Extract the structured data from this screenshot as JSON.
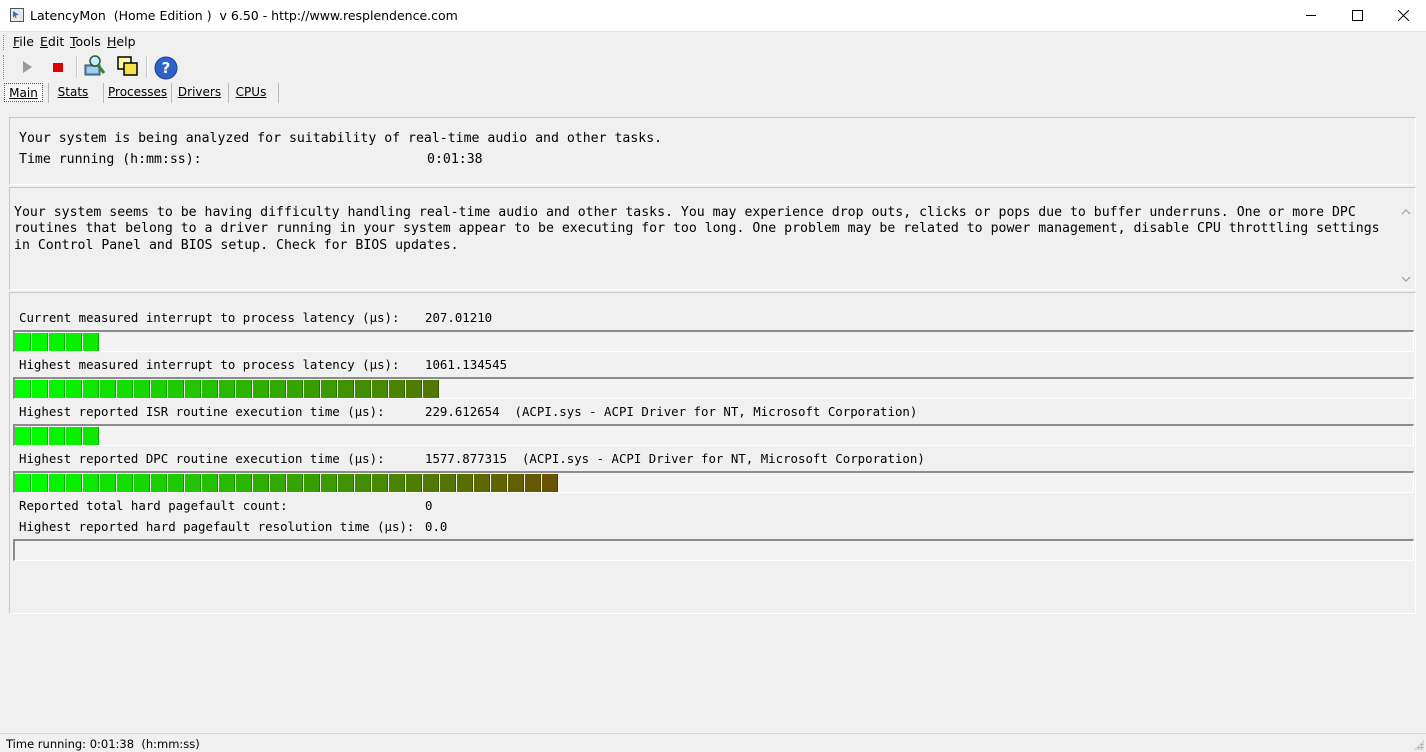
{
  "window": {
    "title": "LatencyMon  (Home Edition )  v 6.50 - http://www.resplendence.com"
  },
  "menu": {
    "items": [
      {
        "label": "File",
        "accel": "F"
      },
      {
        "label": "Edit",
        "accel": "E"
      },
      {
        "label": "Tools",
        "accel": "T"
      },
      {
        "label": "Help",
        "accel": "H"
      }
    ]
  },
  "toolbar": {
    "icons": [
      "play-icon",
      "stop-icon",
      "analyze-icon",
      "windows-icon",
      "help-icon"
    ]
  },
  "tabs": [
    {
      "label": "Main",
      "active": true
    },
    {
      "label": "Stats",
      "active": false
    },
    {
      "label": "Processes",
      "active": false
    },
    {
      "label": "Drivers",
      "active": false
    },
    {
      "label": "CPUs",
      "active": false
    }
  ],
  "status_panel": {
    "message": "Your system is being analyzed for suitability of real-time audio and other tasks.",
    "time_label": "Time running (h:mm:ss):",
    "time_value": "0:01:38"
  },
  "conclusion": {
    "text": "Your system seems to be having difficulty handling real-time audio and other tasks. You may experience drop outs, clicks or pops due to buffer underruns. One or more DPC routines that belong to a driver running in your system appear to be executing for too long. One problem may be related to power management, disable CPU throttling settings in Control Panel and BIOS setup. Check for BIOS updates."
  },
  "metrics": {
    "current_latency": {
      "label": "Current measured interrupt to process latency (µs):",
      "value": "207.01210",
      "segments": 5
    },
    "highest_latency": {
      "label": "Highest measured interrupt to process latency (µs):",
      "value": "1061.134545",
      "segments": 25
    },
    "isr": {
      "label": "Highest reported ISR routine execution time (µs):",
      "value": "229.612654  (ACPI.sys - ACPI Driver for NT, Microsoft Corporation)",
      "segments": 5
    },
    "dpc": {
      "label": "Highest reported DPC routine execution time (µs):",
      "value": "1577.877315  (ACPI.sys - ACPI Driver for NT, Microsoft Corporation)",
      "segments": 32
    },
    "pagefault_count": {
      "label": "Reported total hard pagefault count:",
      "value": "0"
    },
    "pagefault_time": {
      "label": "Highest reported hard pagefault resolution time (µs):",
      "value": "0.0",
      "segments": 0
    }
  },
  "colors": {
    "bar_start": "#00ff00",
    "bar_mid": "#33a600",
    "bar_end": "#6a5300"
  },
  "statusbar": {
    "text": "Time running: 0:01:38  (h:mm:ss)"
  }
}
